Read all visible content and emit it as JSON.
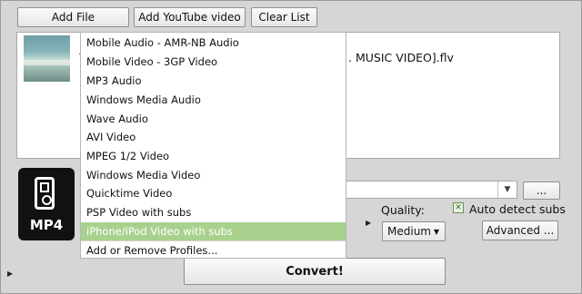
{
  "toolbar": {
    "add_file": "Add File",
    "add_youtube": "Add YouTube video",
    "clear_list": "Clear List"
  },
  "file_list": {
    "items": [
      {
        "name_prefix": "Y",
        "name_suffix": ". MUSIC VIDEO].flv"
      }
    ]
  },
  "profile_icon": {
    "label": "MP4",
    "icon": "ipod-icon"
  },
  "output": {
    "browse_label": "...",
    "quality_label": "Quality:",
    "quality_value": "Medium",
    "auto_detect_subs_label": "Auto detect subs",
    "auto_detect_subs_checked": true,
    "advanced_label": "Advanced ...",
    "convert_label": "Convert!"
  },
  "profile_menu": {
    "items": [
      "Mobile Audio - AMR-NB Audio",
      "Mobile Video - 3GP Video",
      "MP3 Audio",
      "Windows Media Audio",
      "Wave Audio",
      "AVI Video",
      "MPEG 1/2 Video",
      "Windows Media Video",
      "Quicktime Video",
      "PSP Video with subs",
      "iPhone/iPod Video with subs",
      "Add or Remove Profiles..."
    ],
    "selected_index": 10
  },
  "colors": {
    "menu_highlight": "#a9d18e",
    "background": "#d6d6d6"
  }
}
